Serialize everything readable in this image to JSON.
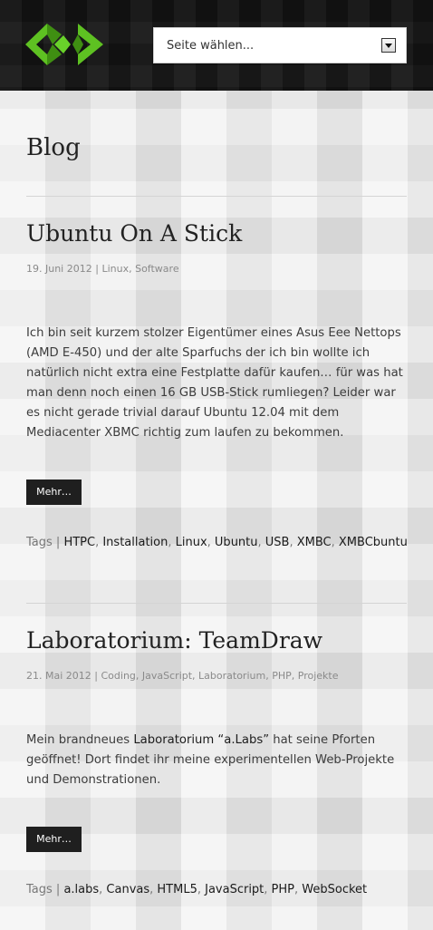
{
  "header": {
    "logo_alt": "",
    "select": {
      "value": "Seite wählen..."
    },
    "colors": {
      "logo_green": "#5ec122",
      "logo_dark_green": "#3f8f12",
      "header_bg": "#161616"
    }
  },
  "page": {
    "title": "Blog"
  },
  "posts": [
    {
      "title": "Ubuntu On A Stick",
      "date": "19. Juni 2012",
      "sep": "|",
      "categories": [
        "Linux",
        "Software"
      ],
      "excerpt": "Ich bin seit kurzem stolzer Eigentümer eines Asus Eee Nettops (AMD E-450) und der alte Sparfuchs der ich bin wollte ich natürlich nicht extra eine Festplatte dafür kaufen… für was hat man denn noch einen 16 GB USB-Stick rumliegen? Leider war es nicht gerade trivial darauf Ubuntu 12.04 mit dem Mediacenter XBMC richtig zum laufen zu bekommen.",
      "more_label": "Mehr…",
      "tags_label": "Tags",
      "tags": [
        "HTPC",
        "Installation",
        "Linux",
        "Ubuntu",
        "USB",
        "XMBC",
        "XMBCbuntu"
      ]
    },
    {
      "title": "Laboratorium: TeamDraw",
      "date": "21. Mai 2012",
      "sep": "|",
      "categories": [
        "Coding",
        "JavaScript",
        "Laboratorium",
        "PHP",
        "Projekte"
      ],
      "excerpt_before": "Mein brandneues ",
      "excerpt_link": "Laboratorium “a.Labs”",
      "excerpt_after": " hat seine Pforten geöffnet! Dort findet ihr meine experimentellen Web-Projekte und Demonstrationen.",
      "more_label": "Mehr…",
      "tags_label": "Tags",
      "tags": [
        "a.labs",
        "Canvas",
        "HTML5",
        "JavaScript",
        "PHP",
        "WebSocket"
      ]
    }
  ]
}
